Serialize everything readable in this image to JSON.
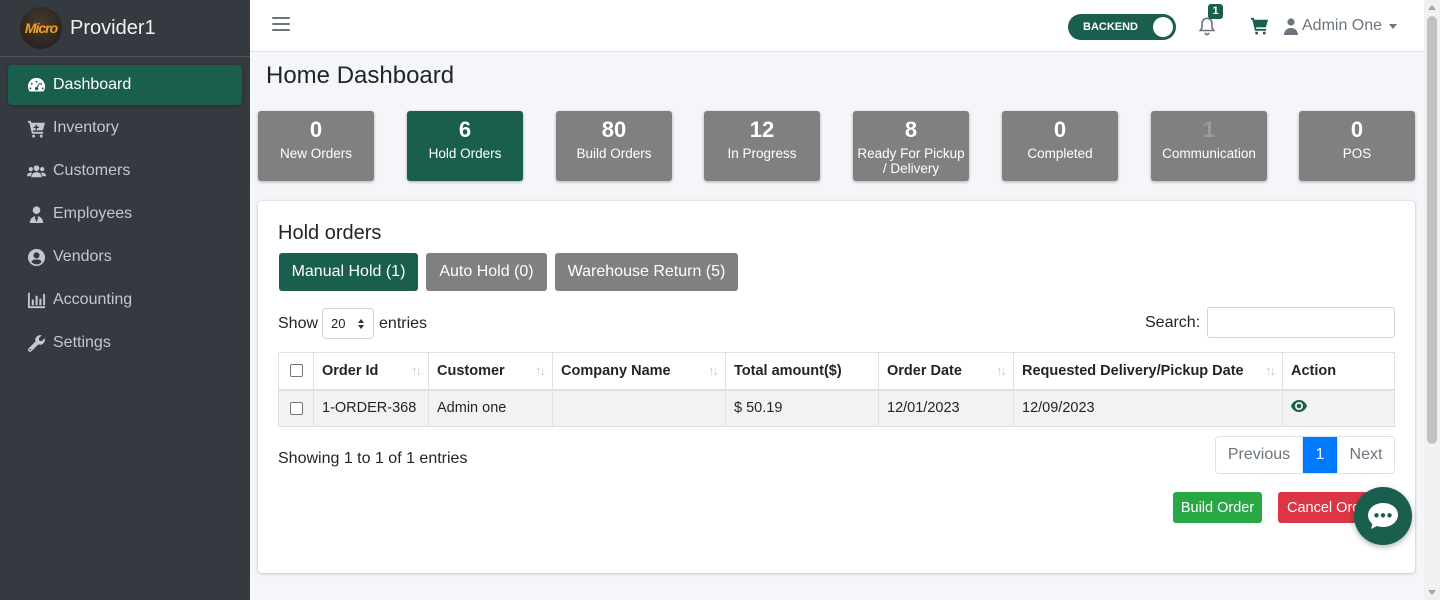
{
  "brand": {
    "logo_text": "Micro",
    "name": "Provider1"
  },
  "sidebar": {
    "items": [
      {
        "label": "Dashboard",
        "icon": "dashboard-gauge-icon",
        "active": true
      },
      {
        "label": "Inventory",
        "icon": "cart-plus-icon"
      },
      {
        "label": "Customers",
        "icon": "users-icon"
      },
      {
        "label": "Employees",
        "icon": "user-tie-icon"
      },
      {
        "label": "Vendors",
        "icon": "user-circle-icon"
      },
      {
        "label": "Accounting",
        "icon": "bar-chart-icon"
      },
      {
        "label": "Settings",
        "icon": "wrench-icon"
      }
    ]
  },
  "topbar": {
    "toggle_label": "BACKEND",
    "notification_count": "1",
    "user_name": "Admin One"
  },
  "page": {
    "title": "Home Dashboard"
  },
  "stats": [
    {
      "value": "0",
      "label": "New Orders"
    },
    {
      "value": "6",
      "label": "Hold Orders",
      "active": true
    },
    {
      "value": "80",
      "label": "Build Orders"
    },
    {
      "value": "12",
      "label": "In Progress"
    },
    {
      "value": "8",
      "label": "Ready For Pickup / Delivery"
    },
    {
      "value": "0",
      "label": "Completed"
    },
    {
      "value": "1",
      "label": "Communication"
    },
    {
      "value": "0",
      "label": "POS"
    }
  ],
  "hold_orders": {
    "title": "Hold orders",
    "tabs": [
      {
        "label": "Manual Hold (1)",
        "active": true
      },
      {
        "label": "Auto Hold (0)"
      },
      {
        "label": "Warehouse Return (5)"
      }
    ],
    "show_label": "Show",
    "entries_value": "20",
    "entries_label": "entries",
    "search_label": "Search:",
    "search_value": "",
    "columns": [
      "Order Id",
      "Customer",
      "Company Name",
      "Total amount($)",
      "Order Date",
      "Requested Delivery/Pickup Date",
      "Action"
    ],
    "rows": [
      {
        "order_id": "1-ORDER-368",
        "customer": "Admin one",
        "company": "",
        "total": "$ 50.19",
        "order_date": "12/01/2023",
        "requested_date": "12/09/2023"
      }
    ],
    "info": "Showing 1 to 1 of 1 entries",
    "pagination": {
      "previous": "Previous",
      "current": "1",
      "next": "Next"
    },
    "build_button": "Build Order",
    "cancel_button": "Cancel Order"
  },
  "colors": {
    "sidebar_bg": "#343a40",
    "primary": "#1a5e4e",
    "stat_gray": "#808080",
    "success": "#28a745",
    "danger": "#dc3545",
    "page_active": "#007bff"
  }
}
